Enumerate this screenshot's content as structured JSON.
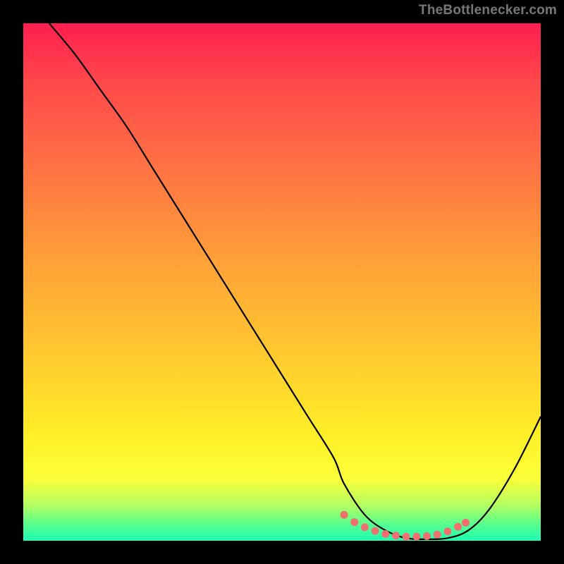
{
  "attribution_text": "TheBottlenecker.com",
  "chart_data": {
    "type": "line",
    "title": "",
    "xlabel": "",
    "ylabel": "",
    "xlim": [
      0,
      100
    ],
    "ylim": [
      0,
      100
    ],
    "series": [
      {
        "name": "bottleneck-curve",
        "x": [
          5,
          10,
          15,
          20,
          25,
          30,
          35,
          40,
          45,
          50,
          55,
          60,
          62,
          66,
          70,
          74,
          78,
          82,
          86,
          90,
          95,
          100
        ],
        "y": [
          100,
          94,
          87,
          80,
          72,
          64,
          56,
          48,
          40,
          32,
          24,
          16,
          11,
          5,
          2,
          0.5,
          0.3,
          0.5,
          2,
          6,
          14,
          24
        ]
      }
    ],
    "markers": {
      "name": "optimal-range-dots",
      "x": [
        62,
        64,
        66,
        68,
        70,
        72,
        74,
        76,
        78,
        80,
        82,
        84,
        85.5
      ],
      "y": [
        5.0,
        3.6,
        2.6,
        1.9,
        1.3,
        1.0,
        0.8,
        0.8,
        0.9,
        1.2,
        1.8,
        2.7,
        3.5
      ]
    },
    "background_gradient": {
      "top": "#ff1f4f",
      "middle": "#ffd82c",
      "bottom": "#1cffb0"
    }
  }
}
